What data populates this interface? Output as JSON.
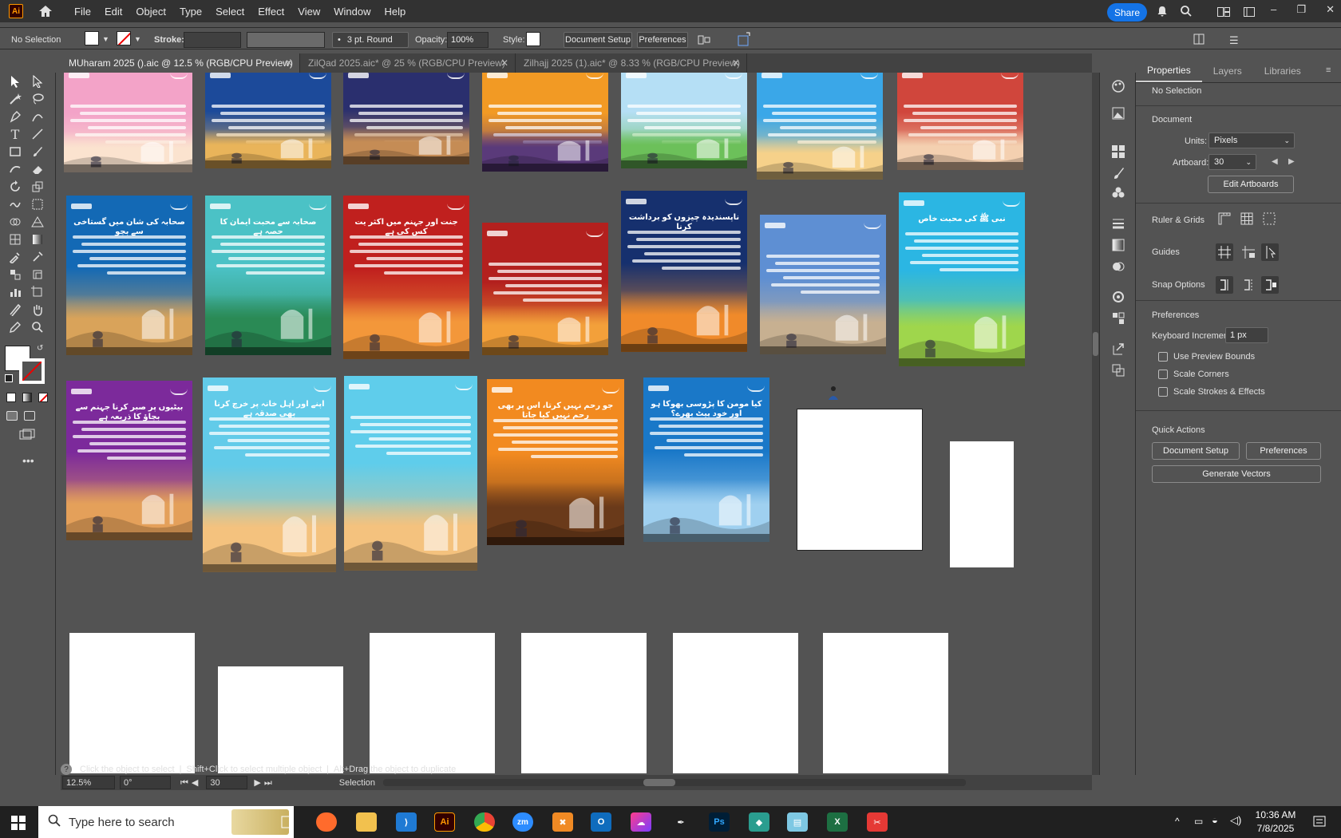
{
  "app": {
    "logo_text": "Ai"
  },
  "menu": [
    "File",
    "Edit",
    "Object",
    "Type",
    "Select",
    "Effect",
    "View",
    "Window",
    "Help"
  ],
  "share_label": "Share",
  "control": {
    "selection": "No Selection",
    "stroke_label": "Stroke:",
    "brush": "3 pt. Round",
    "opacity_label": "Opacity:",
    "opacity_value": "100%",
    "style_label": "Style:",
    "document_setup": "Document Setup",
    "preferences": "Preferences"
  },
  "tabs": [
    {
      "label": "MUharam 2025 ().aic @ 12.5 % (RGB/CPU Preview)",
      "active": true
    },
    {
      "label": "ZilQad 2025.aic* @ 25 % (RGB/CPU Preview)",
      "active": false
    },
    {
      "label": "Zilhajj 2025 (1).aic* @ 8.33 % (RGB/CPU Preview)",
      "active": false
    }
  ],
  "artboards": [
    {
      "title": "",
      "color1": "#f3a3c8",
      "color2": "#fbe3cf"
    },
    {
      "title": "",
      "color1": "#1c4a9a",
      "color2": "#e9b45a"
    },
    {
      "title": "",
      "color1": "#2a2f6e",
      "color2": "#c58c55"
    },
    {
      "title": "",
      "color1": "#f29a24",
      "color2": "#5a3a7a"
    },
    {
      "title": "",
      "color1": "#b5dff5",
      "color2": "#6cc05a"
    },
    {
      "title": "",
      "color1": "#3aa7e8",
      "color2": "#f6d18a"
    },
    {
      "title": "",
      "color1": "#d0463c",
      "color2": "#f4d0b0"
    },
    {
      "title": "صحابہ کی شان میں گستاخی سے بچو",
      "color1": "#1369b5",
      "color2": "#d9a35a"
    },
    {
      "title": "صحابہ سے محبت ایمان کا حصہ ہے",
      "color1": "#4bc2c6",
      "color2": "#2a8a55"
    },
    {
      "title": "جنت اور جہنم میں اکثر یت کس کی ہے",
      "color1": "#c0201e",
      "color2": "#f3973a"
    },
    {
      "title": "",
      "color1": "#b3201e",
      "color2": "#f3a03a"
    },
    {
      "title": "ناپسندیدہ چیزوں کو برداشت کرنا",
      "color1": "#16306e",
      "color2": "#f08a2a"
    },
    {
      "title": "",
      "color1": "#5e8fd3",
      "color2": "#c7b091"
    },
    {
      "title": "نبی ﷺ کی محبت خاص",
      "color1": "#2bb6e3",
      "color2": "#9fd64c"
    },
    {
      "title": "بیٹیوں پر صبر کرنا جہنم سے بچاؤ کا ذریعہ ہے",
      "color1": "#7c2a9b",
      "color2": "#e4a05a"
    },
    {
      "title": "اپنے اور اہل خانہ پر خرچ کرنا بھی صدقہ ہے",
      "color1": "#62cbe9",
      "color2": "#f4c27e"
    },
    {
      "title": "",
      "color1": "#5fcdeb",
      "color2": "#f4c27e"
    },
    {
      "title": "جو رحم نہیں کرتا، اس پر بھی رحم نہیں کیا جاتا",
      "color1": "#f28a20",
      "color2": "#6a3a1a"
    },
    {
      "title": "کیا مومن کا پڑوسی بھوکا ہو اور خود پیٹ بھرے؟",
      "color1": "#1a78c8",
      "color2": "#9fd0f0"
    }
  ],
  "props": {
    "tabs": [
      "Properties",
      "Layers",
      "Libraries"
    ],
    "no_selection": "No Selection",
    "document": "Document",
    "units_label": "Units:",
    "units_value": "Pixels",
    "artboard_label": "Artboard:",
    "artboard_value": "30",
    "edit_artboards": "Edit Artboards",
    "ruler_grids": "Ruler & Grids",
    "guides": "Guides",
    "snap_options": "Snap Options",
    "preferences": "Preferences",
    "keyboard_increment_label": "Keyboard Increment:",
    "keyboard_increment_value": "1 px",
    "use_preview_bounds": "Use Preview Bounds",
    "scale_corners": "Scale Corners",
    "scale_strokes": "Scale Strokes & Effects",
    "quick_actions": "Quick Actions",
    "document_setup": "Document Setup",
    "preferences_btn": "Preferences",
    "generate_vectors": "Generate Vectors"
  },
  "hint": {
    "a": "Click the object to select",
    "b": "Shift+Click to select multiple object",
    "c": "Alt+Drag the object to duplicate"
  },
  "status": {
    "zoom": "12.5%",
    "rotation": "0°",
    "artboard_nav": "30",
    "mode": "Selection"
  },
  "taskbar": {
    "search_placeholder": "Type here to search",
    "time": "10:36 AM",
    "date": "7/8/2025"
  }
}
